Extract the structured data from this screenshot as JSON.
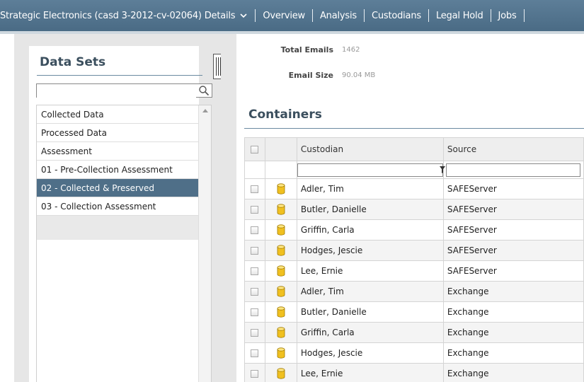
{
  "header": {
    "case_title": "Strategic Electronics (casd 3-2012-cv-02064) Details",
    "nav": [
      "Overview",
      "Analysis",
      "Custodians",
      "Legal Hold",
      "Jobs"
    ]
  },
  "datasets": {
    "title": "Data Sets",
    "search_value": "",
    "items": [
      "Collected Data",
      "Processed Data",
      "Assessment",
      "01 - Pre-Collection Assessment",
      "02 - Collected & Preserved",
      "03 - Collection Assessment"
    ],
    "selected_index": 4
  },
  "stats": {
    "total_emails_label": "Total Emails",
    "total_emails_value": "1462",
    "email_size_label": "Email Size",
    "email_size_value": "90.04 MB"
  },
  "containers": {
    "title": "Containers",
    "columns": {
      "custodian": "Custodian",
      "source": "Source"
    },
    "filter_custodian": "",
    "filter_source": "",
    "rows": [
      {
        "custodian": "Adler, Tim",
        "source": "SAFEServer"
      },
      {
        "custodian": "Butler, Danielle",
        "source": "SAFEServer"
      },
      {
        "custodian": "Griffin, Carla",
        "source": "SAFEServer"
      },
      {
        "custodian": "Hodges, Jescie",
        "source": "SAFEServer"
      },
      {
        "custodian": "Lee, Ernie",
        "source": "SAFEServer"
      },
      {
        "custodian": "Adler, Tim",
        "source": "Exchange"
      },
      {
        "custodian": "Butler, Danielle",
        "source": "Exchange"
      },
      {
        "custodian": "Griffin, Carla",
        "source": "Exchange"
      },
      {
        "custodian": "Hodges, Jescie",
        "source": "Exchange"
      },
      {
        "custodian": "Lee, Ernie",
        "source": "Exchange"
      }
    ]
  },
  "colors": {
    "header_bg": "#4f6f88",
    "selected_row": "#4f6f88",
    "title_text": "#3b4f5e",
    "db_icon": "#f0c020"
  },
  "icons": [
    "chevron-down-icon",
    "search-icon",
    "funnel-icon",
    "database-icon",
    "collapse-handle-icon"
  ]
}
